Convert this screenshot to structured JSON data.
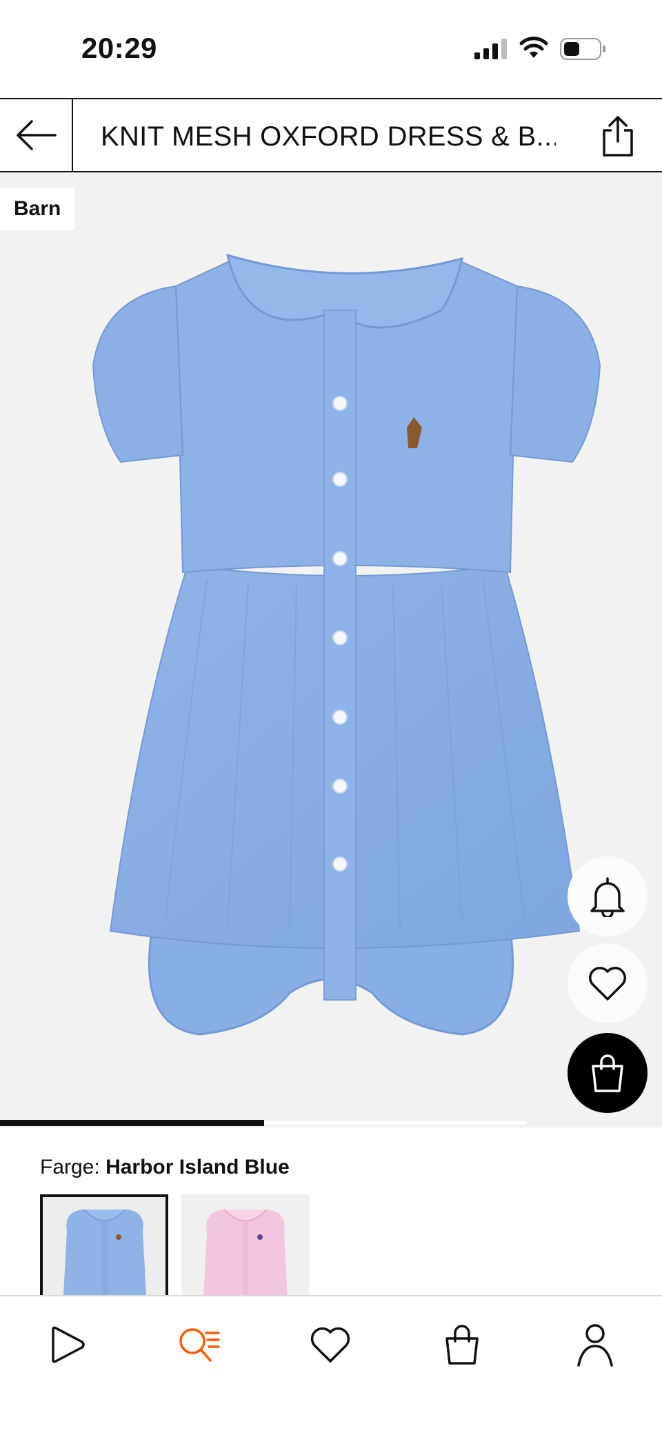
{
  "status_bar": {
    "time": "20:29"
  },
  "header": {
    "title": "KNIT MESH OXFORD DRESS & B...",
    "back_icon": "arrow-left-icon",
    "share_icon": "share-icon"
  },
  "product": {
    "category_badge": "Barn",
    "image_progress": 0.4
  },
  "actions": {
    "alert_icon": "bell-icon",
    "wishlist_icon": "heart-icon",
    "bag_icon": "shopping-bag-icon"
  },
  "color": {
    "label": "Farge:",
    "selected": "Harbor Island Blue",
    "swatches": [
      {
        "name": "Harbor Island Blue",
        "color": "#8fb3e6",
        "selected": true
      },
      {
        "name": "Pink",
        "color": "#f2c4dc",
        "selected": false
      }
    ]
  },
  "bottom_nav": {
    "items": [
      {
        "icon": "play-icon",
        "active": false
      },
      {
        "icon": "search-icon",
        "active": true
      },
      {
        "icon": "heart-icon",
        "active": false
      },
      {
        "icon": "bag-icon",
        "active": false
      },
      {
        "icon": "profile-icon",
        "active": false
      }
    ],
    "active_color": "#ff5a00"
  }
}
